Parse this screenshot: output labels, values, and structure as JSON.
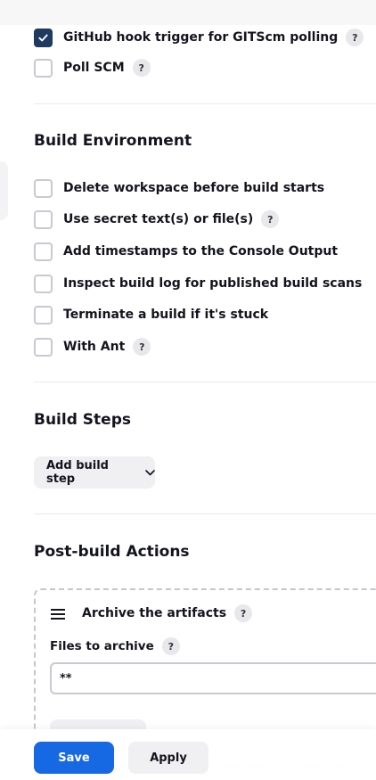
{
  "triggers": {
    "items": [
      {
        "label": "GitHub hook trigger for GITScm polling",
        "checked": true,
        "help": "?"
      },
      {
        "label": "Poll SCM",
        "checked": false,
        "help": "?"
      }
    ]
  },
  "build_environment": {
    "title": "Build Environment",
    "items": [
      {
        "label": "Delete workspace before build starts",
        "checked": false
      },
      {
        "label": "Use secret text(s) or file(s)",
        "checked": false,
        "help": "?"
      },
      {
        "label": "Add timestamps to the Console Output",
        "checked": false
      },
      {
        "label": "Inspect build log for published build scans",
        "checked": false
      },
      {
        "label": "Terminate a build if it's stuck",
        "checked": false
      },
      {
        "label": "With Ant",
        "checked": false,
        "help": "?"
      }
    ]
  },
  "build_steps": {
    "title": "Build Steps",
    "add_label": "Add build step"
  },
  "post_build": {
    "title": "Post-build Actions",
    "archive": {
      "title": "Archive the artifacts",
      "help": "?",
      "files_label": "Files to archive",
      "files_help": "?",
      "files_value": "**"
    }
  },
  "footer": {
    "save_label": "Save",
    "apply_label": "Apply"
  },
  "colors": {
    "primary": "#1668e3",
    "checked": "#1f3a5f"
  }
}
